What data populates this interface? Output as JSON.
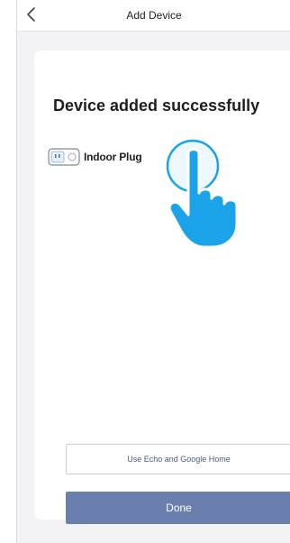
{
  "header": {
    "title": "Add Device",
    "back_icon": "chevron-left-icon"
  },
  "main": {
    "headline": "Device added successfully",
    "device": {
      "icon": "smart-plug-icon",
      "name": "Indoor Plug"
    },
    "edit_icon": "pencil-icon",
    "tap_hint_icon": "pointing-hand-icon",
    "tap_hint_color": "#1aa3e8"
  },
  "buttons": {
    "echo_label": "Use Echo and Google Home",
    "done_label": "Done",
    "done_color": "#6a7fae"
  }
}
